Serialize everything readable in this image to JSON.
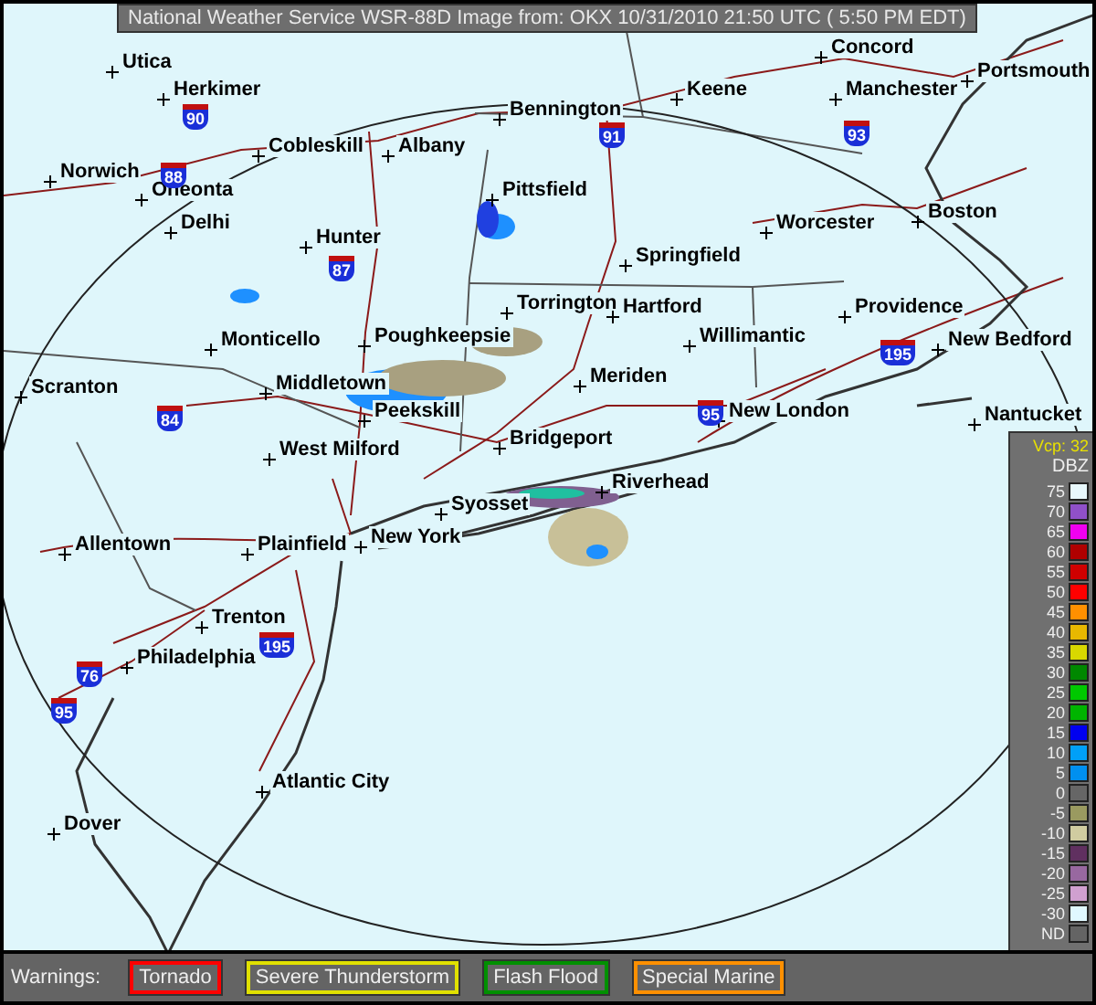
{
  "title_bar": {
    "text": "National Weather Service WSR-88D Image from: OKX 10/31/2010 21:50 UTC ( 5:50 PM EDT)"
  },
  "map": {
    "cities": [
      {
        "name": "Concord"
      },
      {
        "name": "Utica"
      },
      {
        "name": "Portsmouth"
      },
      {
        "name": "Herkimer"
      },
      {
        "name": "Keene"
      },
      {
        "name": "Manchester"
      },
      {
        "name": "Bennington"
      },
      {
        "name": "Cobleskill"
      },
      {
        "name": "Albany"
      },
      {
        "name": "Norwich"
      },
      {
        "name": "Oneonta"
      },
      {
        "name": "Pittsfield"
      },
      {
        "name": "Boston"
      },
      {
        "name": "Delhi"
      },
      {
        "name": "Worcester"
      },
      {
        "name": "Hunter"
      },
      {
        "name": "Springfield"
      },
      {
        "name": "Torrington"
      },
      {
        "name": "Hartford"
      },
      {
        "name": "Providence"
      },
      {
        "name": "Monticello"
      },
      {
        "name": "Poughkeepsie"
      },
      {
        "name": "Willimantic"
      },
      {
        "name": "New Bedford"
      },
      {
        "name": "Scranton"
      },
      {
        "name": "Middletown"
      },
      {
        "name": "Meriden"
      },
      {
        "name": "Peekskill"
      },
      {
        "name": "New London"
      },
      {
        "name": "Nantucket"
      },
      {
        "name": "West Milford"
      },
      {
        "name": "Bridgeport"
      },
      {
        "name": "Riverhead"
      },
      {
        "name": "Syosset"
      },
      {
        "name": "Allentown"
      },
      {
        "name": "Plainfield"
      },
      {
        "name": "New York"
      },
      {
        "name": "Trenton"
      },
      {
        "name": "Philadelphia"
      },
      {
        "name": "Atlantic City"
      },
      {
        "name": "Dover"
      }
    ],
    "interstate_shields": [
      {
        "number": "90"
      },
      {
        "number": "91"
      },
      {
        "number": "93"
      },
      {
        "number": "88"
      },
      {
        "number": "87"
      },
      {
        "number": "195"
      },
      {
        "number": "84"
      },
      {
        "number": "95"
      },
      {
        "number": "195"
      },
      {
        "number": "76"
      },
      {
        "number": "95"
      }
    ]
  },
  "legend": {
    "vcp": "Vcp: 32",
    "unit": "DBZ",
    "levels": [
      {
        "label": "75",
        "color": "#e8f8fc"
      },
      {
        "label": "70",
        "color": "#9050c8"
      },
      {
        "label": "65",
        "color": "#f000f0"
      },
      {
        "label": "60",
        "color": "#b00000"
      },
      {
        "label": "55",
        "color": "#d00000"
      },
      {
        "label": "50",
        "color": "#ff0000"
      },
      {
        "label": "45",
        "color": "#ff9000"
      },
      {
        "label": "40",
        "color": "#e8b800"
      },
      {
        "label": "35",
        "color": "#d8d800"
      },
      {
        "label": "30",
        "color": "#008800"
      },
      {
        "label": "25",
        "color": "#00c800"
      },
      {
        "label": "20",
        "color": "#00b400"
      },
      {
        "label": "15",
        "color": "#0000f0"
      },
      {
        "label": "10",
        "color": "#00a0f8"
      },
      {
        "label": "5",
        "color": "#0090f0"
      },
      {
        "label": "0",
        "color": "#666666"
      },
      {
        "label": "-5",
        "color": "#9a9a60"
      },
      {
        "label": "-10",
        "color": "#d0cca0"
      },
      {
        "label": "-15",
        "color": "#603060"
      },
      {
        "label": "-20",
        "color": "#9868a0"
      },
      {
        "label": "-25",
        "color": "#d0a0d0"
      },
      {
        "label": "-30",
        "color": "#e0f8ff"
      },
      {
        "label": "ND",
        "color": "#646464"
      }
    ]
  },
  "warnings": {
    "label": "Warnings:",
    "items": [
      {
        "label": "Tornado",
        "color": "#ff0000"
      },
      {
        "label": "Severe Thunderstorm",
        "color": "#e0e000"
      },
      {
        "label": "Flash Flood",
        "color": "#009000"
      },
      {
        "label": "Special Marine",
        "color": "#ff9000"
      }
    ]
  }
}
